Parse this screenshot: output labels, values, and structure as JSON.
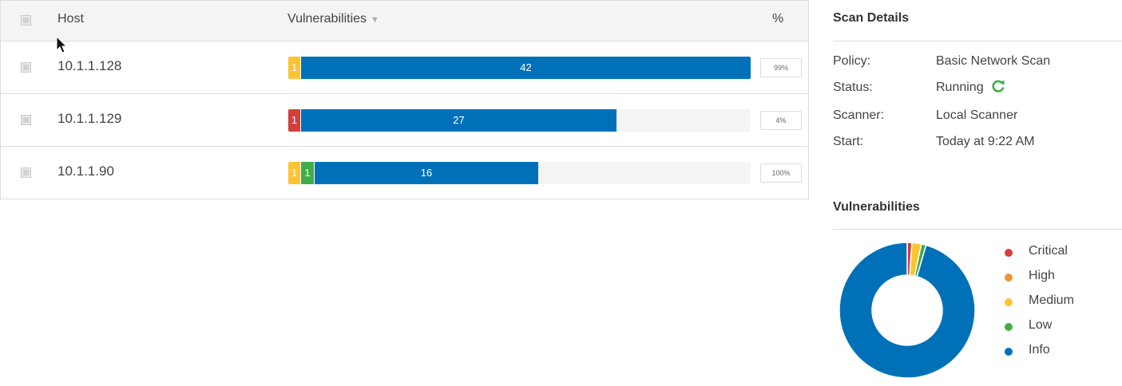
{
  "table": {
    "columns": {
      "host": "Host",
      "vulnerabilities": "Vulnerabilities",
      "percent": "%"
    },
    "sort_indicator": "▼",
    "rows": [
      {
        "host": "10.1.1.128",
        "percent": "99%",
        "segments": [
          {
            "severity": "medium",
            "count": "1"
          },
          {
            "severity": "info",
            "count": "42"
          }
        ]
      },
      {
        "host": "10.1.1.129",
        "percent": "4%",
        "segments": [
          {
            "severity": "critical",
            "count": "1"
          },
          {
            "severity": "info",
            "count": "27"
          }
        ]
      },
      {
        "host": "10.1.1.90",
        "percent": "100%",
        "segments": [
          {
            "severity": "medium",
            "count": "1"
          },
          {
            "severity": "low",
            "count": "1"
          },
          {
            "severity": "info",
            "count": "16"
          }
        ]
      }
    ]
  },
  "scan_details": {
    "title": "Scan Details",
    "policy_label": "Policy:",
    "policy_value": "Basic Network Scan",
    "status_label": "Status:",
    "status_value": "Running",
    "status_icon": "refresh-icon",
    "scanner_label": "Scanner:",
    "scanner_value": "Local Scanner",
    "start_label": "Start:",
    "start_value": "Today at 9:22 AM"
  },
  "vulnerabilities": {
    "title": "Vulnerabilities",
    "legend": [
      {
        "key": "critical",
        "label": "Critical"
      },
      {
        "key": "high",
        "label": "High"
      },
      {
        "key": "medium",
        "label": "Medium"
      },
      {
        "key": "low",
        "label": "Low"
      },
      {
        "key": "info",
        "label": "Info"
      }
    ]
  },
  "colors": {
    "critical": "#d43f3a",
    "high": "#ee9336",
    "medium": "#fdc431",
    "low": "#3fae49",
    "info": "#0071b9",
    "running_icon": "#3fae49"
  },
  "chart_data": {
    "type": "pie",
    "variant": "donut",
    "labels": [
      "Critical",
      "High",
      "Medium",
      "Low",
      "Info"
    ],
    "values": [
      1,
      0,
      2,
      1,
      85
    ]
  }
}
